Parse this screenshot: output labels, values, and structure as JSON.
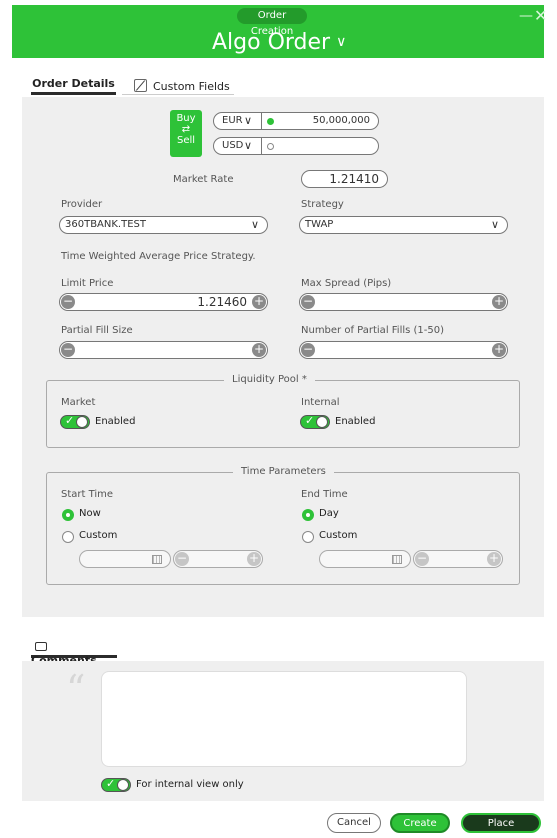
{
  "header": {
    "badge": "Order Creation",
    "title": "Algo Order",
    "title_chevron": "∨",
    "minimize_glyph": "—",
    "close_glyph": "✕"
  },
  "tabs": {
    "order_details": "Order Details",
    "custom_fields": "Custom Fields"
  },
  "trade": {
    "buy": "Buy",
    "arrows": "⇄",
    "sell": "Sell",
    "ccy1": "EUR",
    "ccy2": "USD",
    "amount1": "50,000,000",
    "amount2": "",
    "market_rate_label": "Market Rate",
    "market_rate": "1.21410"
  },
  "provider": {
    "label": "Provider",
    "value": "360TBANK.TEST"
  },
  "strategy": {
    "label": "Strategy",
    "value": "TWAP",
    "description": "Time Weighted Average Price Strategy."
  },
  "limit_price": {
    "label": "Limit Price",
    "value": "1.21460"
  },
  "max_spread": {
    "label": "Max Spread (Pips)",
    "value": ""
  },
  "partial_fill_size": {
    "label": "Partial Fill Size",
    "value": ""
  },
  "num_partial_fills": {
    "label": "Number of Partial Fills (1-50)",
    "value": ""
  },
  "liquidity": {
    "title": "Liquidity Pool *",
    "market_label": "Market",
    "market_state": "Enabled",
    "internal_label": "Internal",
    "internal_state": "Enabled"
  },
  "time": {
    "title": "Time Parameters",
    "start_label": "Start Time",
    "start_now": "Now",
    "start_custom": "Custom",
    "end_label": "End Time",
    "end_day": "Day",
    "end_custom": "Custom"
  },
  "comments": {
    "tab": "Comments",
    "quote_glyph": "“",
    "text": "",
    "internal_label": "For internal view only"
  },
  "buttons": {
    "cancel": "Cancel",
    "create": "Create",
    "place": "Place"
  },
  "colors": {
    "accent": "#2ec238",
    "dark_button": "#1a3a1c"
  }
}
